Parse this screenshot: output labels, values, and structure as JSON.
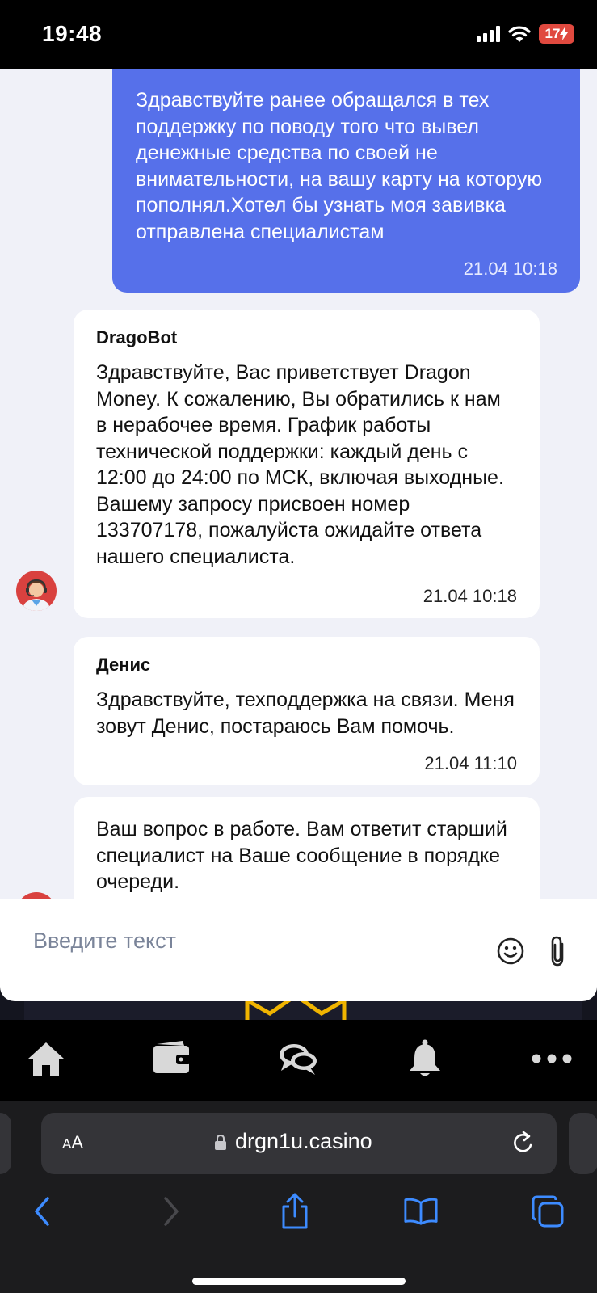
{
  "status_bar": {
    "time": "19:48",
    "battery": "17"
  },
  "chat": {
    "outgoing": {
      "text": "Здравствуйте ранее обращался в тех поддержку по поводу того что вывел денежные средства по своей не внимательности, на вашу карту на которую пополнял.Хотел бы узнать моя завивка отправлена специалистам",
      "time": "21.04 10:18"
    },
    "messages": [
      {
        "sender": "DragoBot",
        "text": "Здравствуйте, Вас приветствует Dragon Money. К сожалению, Вы обратились к нам в нерабочее время. График работы технической поддержки: каждый день с 12:00 до 24:00 по МСК, включая выходные. Вашему запросу присвоен номер 133707178, пожалуйста ожидайте ответа нашего специалиста.",
        "time": "21.04 10:18"
      },
      {
        "sender": "Денис",
        "text": "Здравствуйте, техподдержка на связи. Меня зовут Денис, постараюсь Вам помочь.",
        "time": "21.04 11:10"
      },
      {
        "text": "Ваш вопрос в работе. Вам ответит старший специалист на Ваше сообщение в порядке очереди."
      }
    ]
  },
  "input": {
    "placeholder": "Введите текст"
  },
  "safari": {
    "text_size_label_small": "A",
    "text_size_label_large": "A",
    "url": "drgn1u.casino"
  },
  "icons": {
    "nav": [
      "home-icon",
      "wallet-icon",
      "chat-icon",
      "bell-icon",
      "more-icon"
    ],
    "input": [
      "emoji-icon",
      "paperclip-icon"
    ],
    "toolbar": [
      "back-icon",
      "forward-icon",
      "share-icon",
      "bookmarks-icon",
      "tabs-icon"
    ]
  },
  "colors": {
    "outgoing_bubble": "#5670ea",
    "chat_background": "#f0f1f8",
    "avatar": "#d9413f",
    "battery": "#e0493f",
    "safari_accent": "#3d8bff"
  }
}
